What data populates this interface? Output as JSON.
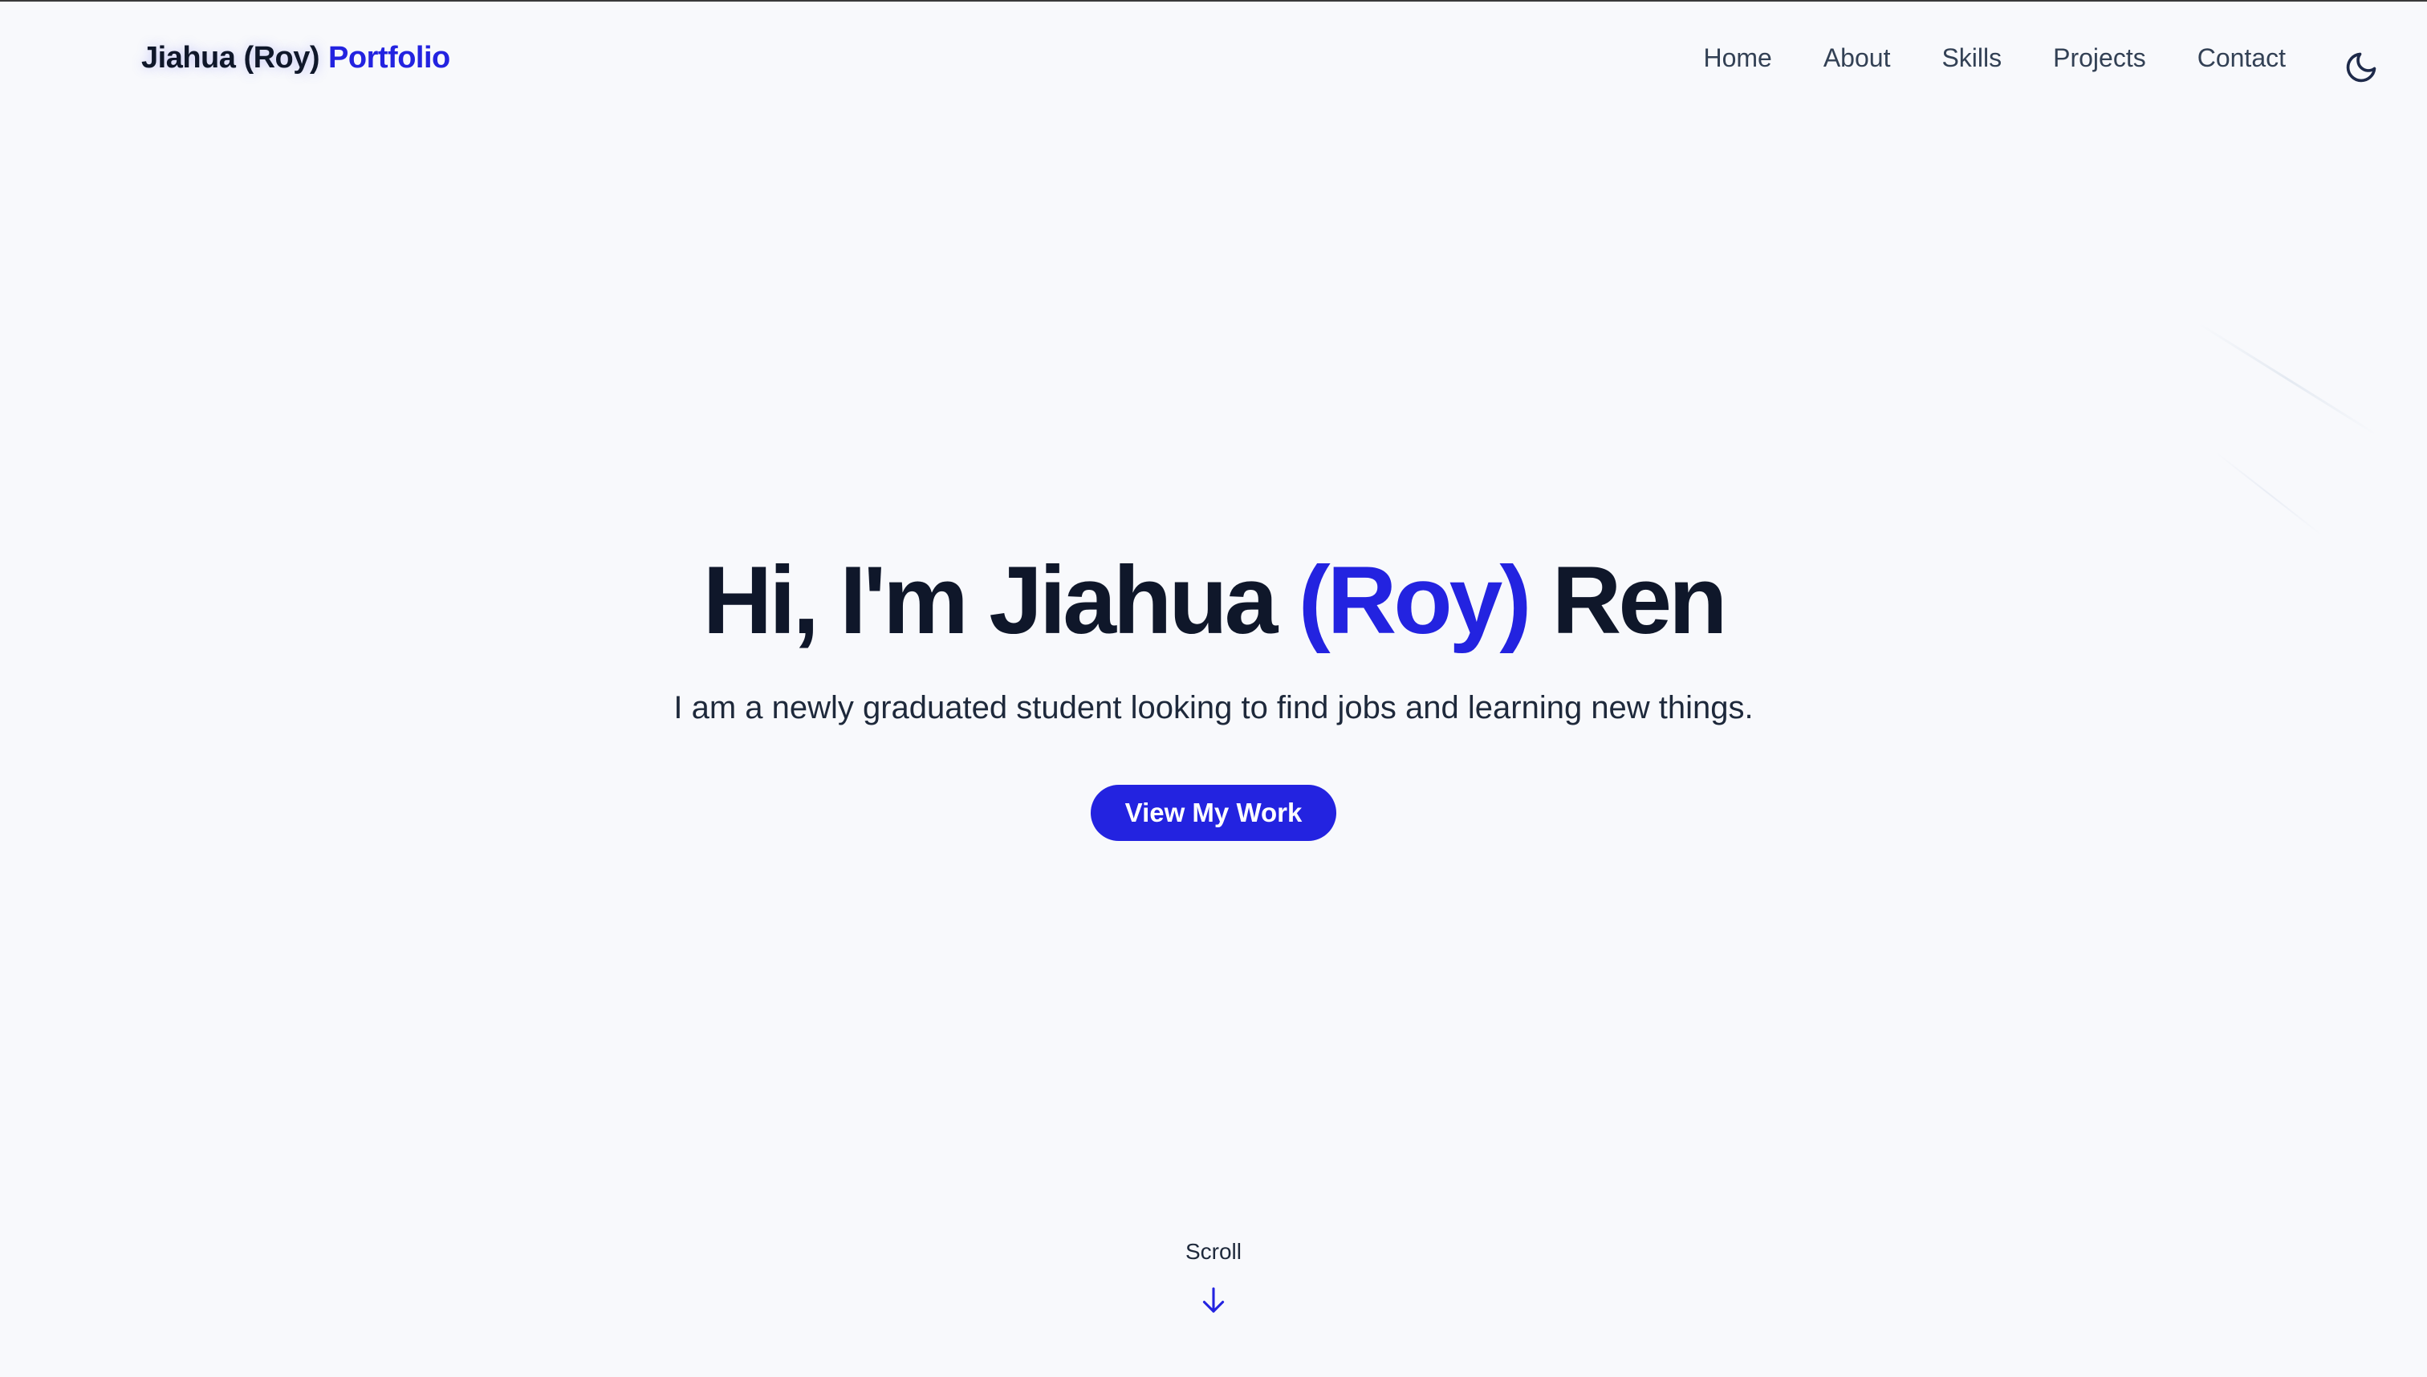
{
  "header": {
    "brand_name": "Jiahua (Roy)",
    "brand_accent": "Portfolio",
    "nav": [
      "Home",
      "About",
      "Skills",
      "Projects",
      "Contact"
    ],
    "theme_icon": "moon-icon"
  },
  "hero": {
    "title_prefix": "Hi, I'm Jiahua ",
    "title_accent": "(Roy)",
    "title_suffix": " Ren",
    "subtitle": "I am a newly graduated student looking to find jobs and learning new things.",
    "cta_label": "View My Work"
  },
  "scroll": {
    "label": "Scroll",
    "icon": "arrow-down-icon"
  },
  "colors": {
    "accent": "#2323e0",
    "text": "#0f172a",
    "background": "#f8f9fc"
  }
}
